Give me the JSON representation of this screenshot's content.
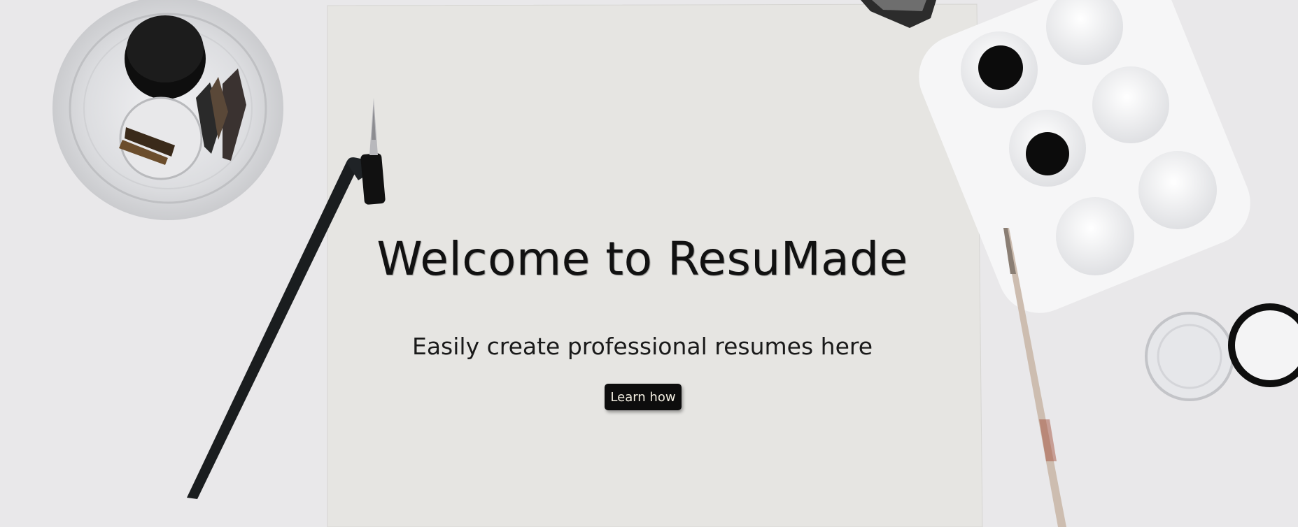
{
  "hero": {
    "title": "Welcome to ResuMade",
    "subtitle": "Easily create professional resumes here",
    "cta_label": "Learn how"
  }
}
